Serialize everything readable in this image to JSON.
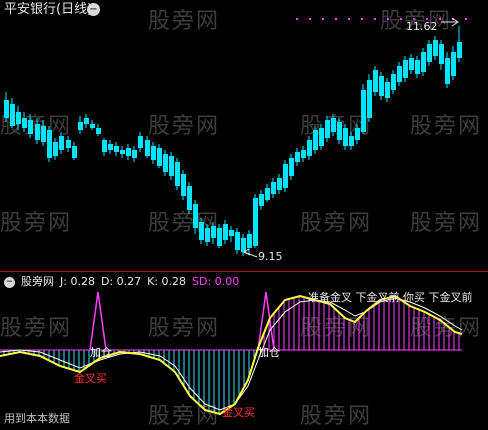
{
  "window": {
    "title": "平安银行(日线)",
    "collapse_icon": "−"
  },
  "watermark": {
    "text": "股旁网"
  },
  "main_chart": {
    "high_label": "11.62",
    "low_label": "9.15"
  },
  "indicator": {
    "collapse_icon": "−",
    "name": "股旁网",
    "j_label": "J: 0.28",
    "d_label": "D: 0.27",
    "k_label": "K: 0.28",
    "sd_label": "SD: 0.00",
    "signals": {
      "add1": "加仓",
      "golden_cross_buy": "金叉买",
      "add2": "加仓",
      "golden_cross_buy2": "金叉买",
      "bottom_text": "用到本本数据",
      "top_text": "准备金叉 下金叉前 你买 下金叉前"
    }
  },
  "colors": {
    "bg": "#000000",
    "up": "#ff3030",
    "down": "#00e5ff",
    "k_line": "#ffff40",
    "d_line": "#ffffff",
    "bar_pos": "#ff40ff",
    "bar_neg": "#40e0ff",
    "spike": "#ff40ff",
    "separator": "#b01010"
  }
}
